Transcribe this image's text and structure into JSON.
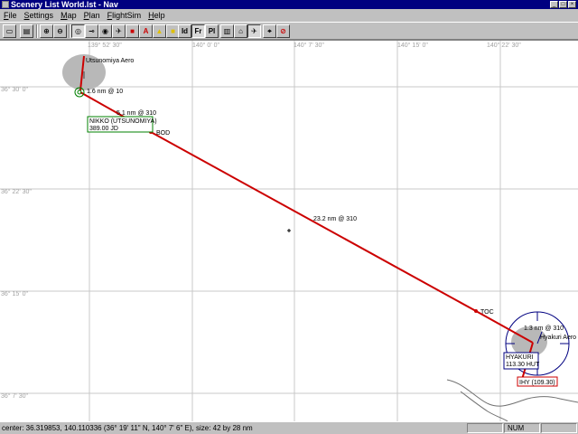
{
  "window": {
    "title": "Scenery List World.lst - Nav",
    "controls": [
      "_",
      "□",
      "×"
    ]
  },
  "menu": [
    "File",
    "Settings",
    "Map",
    "Plan",
    "FlightSim",
    "Help"
  ],
  "toolbar": {
    "buttons": [
      {
        "icon": "open-folder-icon",
        "glyph": "▭"
      },
      {
        "icon": "print-icon",
        "glyph": "▤"
      },
      {
        "icon": "zoom-in-icon",
        "glyph": "⊕"
      },
      {
        "icon": "zoom-out-icon",
        "glyph": "⊖"
      },
      {
        "icon": "vor-icon",
        "glyph": "◎"
      },
      {
        "icon": "ils-icon",
        "glyph": "⊸"
      },
      {
        "icon": "ndb-icon",
        "glyph": "◉"
      },
      {
        "icon": "airport-icon",
        "glyph": "✈"
      },
      {
        "icon": "marker-icon",
        "glyph": "■"
      },
      {
        "icon": "atc-icon",
        "glyph": "A"
      },
      {
        "icon": "warning-icon",
        "glyph": "▲"
      },
      {
        "icon": "stop-icon",
        "glyph": "■"
      },
      {
        "icon": "id-label-icon",
        "glyph": "Id"
      },
      {
        "icon": "frequency-label-icon",
        "glyph": "Fr"
      },
      {
        "icon": "name-label-icon",
        "glyph": "Pl"
      },
      {
        "icon": "book-icon",
        "glyph": "▥"
      },
      {
        "icon": "home-icon",
        "glyph": "⌂"
      },
      {
        "icon": "aircraft-icon",
        "glyph": "✈"
      },
      {
        "icon": "gps-icon",
        "glyph": "⌖"
      },
      {
        "icon": "no-entry-icon",
        "glyph": "⊘"
      }
    ]
  },
  "map": {
    "lon_labels": [
      "139° 52' 30\"",
      "140° 0' 0\"",
      "140° 7' 30\"",
      "140° 15' 0\"",
      "140° 22' 30\""
    ],
    "lat_labels": [
      "36° 30' 0\"",
      "36° 22' 30\"",
      "36° 15' 0\"",
      "36° 7' 30\""
    ],
    "airports": [
      {
        "name": "Utsunomiya Aero"
      },
      {
        "name": "Hyakuri Aero"
      }
    ],
    "navaids": [
      {
        "name": "NIKKO (UTSUNOMIYA)",
        "freq": "389.00 JD"
      },
      {
        "name": "HYAKURI",
        "freq": "113.30 HUT"
      },
      {
        "name": "IHY (109.30)"
      }
    ],
    "waypoints": [
      "BOD",
      "TOC"
    ],
    "legs": [
      "1.6 nm @ 10",
      "5.1 nm @ 310",
      "23.2 nm @ 310",
      "1.3 nm @ 310"
    ],
    "colors": {
      "route": "#cc0000",
      "grid": "#c0c0c0",
      "navaid": "#008000",
      "airport": "#b0b0b0"
    }
  },
  "status": {
    "text": "center: 36.319853, 140.110336 (36° 19' 11\" N, 140° 7' 6\" E), size: 42 by 28 nm",
    "num": "NUM"
  }
}
